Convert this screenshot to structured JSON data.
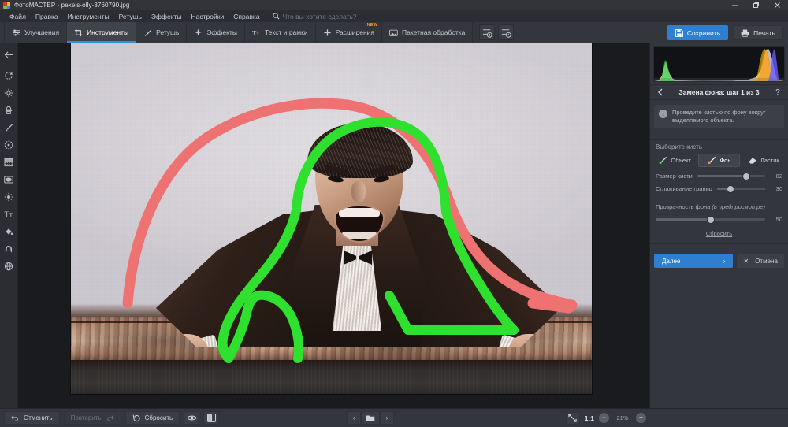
{
  "window": {
    "title": "ФотоМАСТЕР - pexels-olly-3760790.jpg",
    "minimize": "—",
    "restore": "❐",
    "close": "✕"
  },
  "menubar": {
    "items": [
      "Файл",
      "Правка",
      "Инструменты",
      "Ретушь",
      "Эффекты",
      "Настройки",
      "Справка"
    ],
    "search_placeholder": "Что вы хотите сделать?"
  },
  "toolbar": {
    "tabs": [
      {
        "label": "Улучшения",
        "icon": "sliders-icon",
        "active": false,
        "badge": ""
      },
      {
        "label": "Инструменты",
        "icon": "crop-icon",
        "active": true,
        "badge": ""
      },
      {
        "label": "Ретушь",
        "icon": "brush-icon",
        "active": false,
        "badge": ""
      },
      {
        "label": "Эффекты",
        "icon": "sparkle-icon",
        "active": false,
        "badge": ""
      },
      {
        "label": "Текст и рамки",
        "icon": "text-icon",
        "active": false,
        "badge": ""
      },
      {
        "label": "Расширения",
        "icon": "plus-icon",
        "active": false,
        "badge": "NEW"
      },
      {
        "label": "Пакетная обработка",
        "icon": "images-icon",
        "active": false,
        "badge": ""
      }
    ],
    "preset_add": "preset-add-icon",
    "preset_time": "preset-history-icon",
    "save_label": "Сохранить",
    "print_label": "Печать"
  },
  "rail": {
    "items": [
      {
        "name": "back-arrow-icon"
      },
      {
        "name": "rotate-icon"
      },
      {
        "name": "healing-brush-icon"
      },
      {
        "name": "stamp-icon"
      },
      {
        "name": "brush-icon"
      },
      {
        "name": "radial-filter-icon"
      },
      {
        "name": "graduated-filter-icon"
      },
      {
        "name": "vignette-icon"
      },
      {
        "name": "light-icon"
      },
      {
        "name": "text-icon"
      },
      {
        "name": "fill-icon"
      },
      {
        "name": "magnet-icon"
      },
      {
        "name": "globe-icon"
      }
    ]
  },
  "panel": {
    "title": "Замена фона: шаг 1 из 3",
    "back_icon": "chevron-left-icon",
    "help_icon": "question-mark-icon",
    "info_text": "Проведите кистью по фону вокруг выделяемого объекта.",
    "brush_section_label": "Выберите кисть",
    "brushes": [
      {
        "label": "Объект",
        "icon": "brush-green-icon",
        "active": false
      },
      {
        "label": "Фон",
        "icon": "brush-orange-icon",
        "active": true
      },
      {
        "label": "Ластик",
        "icon": "eraser-icon",
        "active": false
      }
    ],
    "sliders": [
      {
        "label": "Размер кисти",
        "value": "82",
        "percent": 72,
        "inline": true
      },
      {
        "label": "Сглаживание границ",
        "value": "30",
        "percent": 27,
        "inline": true
      },
      {
        "label": "Прозрачность фона ",
        "label_italic": "(в предпросмотре)",
        "value": "50",
        "percent": 50,
        "inline": false
      }
    ],
    "reset_label": "Сбросить",
    "next_label": "Далее",
    "next_arrow": "›",
    "cancel_label": "Отмена",
    "cancel_icon": "✕"
  },
  "bottombar": {
    "undo_label": "Отменить",
    "redo_label": "Повторить",
    "reset_label": "Сбросить",
    "eye_icon": "eye-icon",
    "compare_icon": "before-after-icon",
    "nav_prev": "‹",
    "nav_folder": "folder-icon",
    "nav_next": "›",
    "fit_icon": "fit-screen-icon",
    "actual_size": "1:1",
    "zoom_out": "−",
    "zoom_level": "21%",
    "zoom_in": "+"
  },
  "colors": {
    "accent": "#2f7fd0",
    "panel_bg": "#34363d",
    "canvas_bg": "#1a1b1f",
    "object_stroke": "#2fe02f",
    "background_stroke": "#ef6e6e",
    "badge_new": "#f0a030"
  }
}
